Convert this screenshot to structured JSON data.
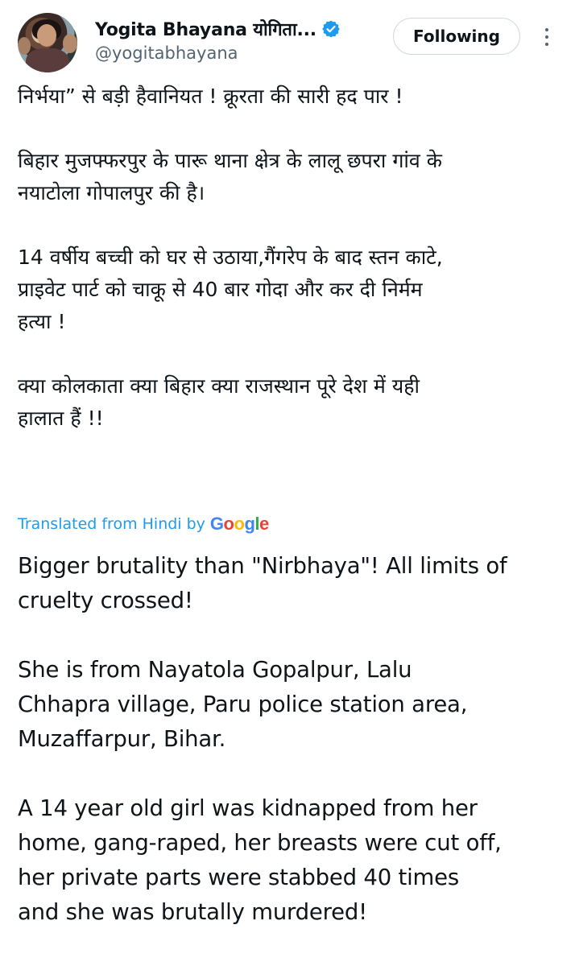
{
  "author": {
    "display_name": "Yogita Bhayana योगिता...",
    "handle": "@yogitabhayana",
    "verified": true
  },
  "actions": {
    "follow_label": "Following",
    "more_icon": "more-vertical-icon"
  },
  "tweet": {
    "hindi": [
      "निर्भया” से बड़ी हैवानियत ! क्रूरता की सारी हद पार !",
      "बिहार मुजफ्फरपुर के पारू थाना क्षेत्र के लालू छपरा गांव के\nनयाटोला गोपालपुर की है।",
      "14 वर्षीय बच्ची को घर से उठाया,गैंगरेप के बाद स्तन काटे,\nप्राइवेट पार्ट को चाकू से 40 बार गोदा और कर दी निर्मम\nहत्या !",
      "क्या कोलकाता क्या बिहार क्या राजस्थान पूरे देश में यही\nहालात हैं !!"
    ],
    "translation_label": "Translated from Hindi by",
    "translation_provider": "Google",
    "english": [
      "Bigger brutality than \"Nirbhaya\"! All limits of\ncruelty crossed!",
      "She is from Nayatola Gopalpur, Lalu\nChhapra village, Paru police station area,\nMuzaffarpur, Bihar.",
      "A 14 year old girl was kidnapped from her\nhome, gang-raped, her breasts were cut off,\nher private parts were stabbed 40 times\nand she was brutally murdered!"
    ]
  },
  "colors": {
    "text": "#0f1419",
    "secondary": "#536471",
    "accent": "#1d9bf0",
    "border": "#cfd9de"
  }
}
